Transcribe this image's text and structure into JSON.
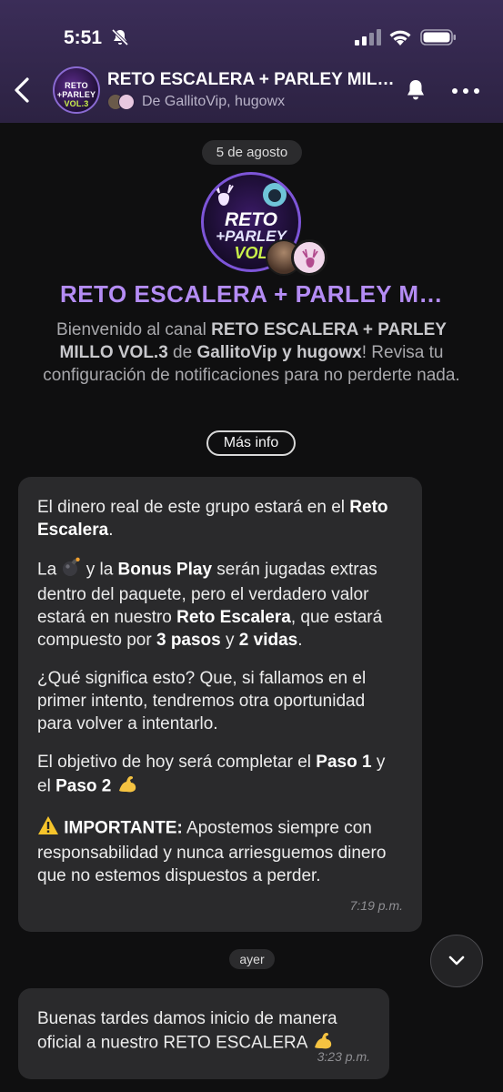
{
  "status_bar": {
    "time": "5:51"
  },
  "header": {
    "title": "RETO ESCALERA + PARLEY MIL…",
    "subtitle": "De GallitoVip, hugowx",
    "avatar_lines": [
      "RETO",
      "+PARLEY",
      "VOL.3"
    ]
  },
  "channel_intro": {
    "date": "5 de agosto",
    "avatar_lines": [
      "RETO",
      "+PARLEY",
      "VOL"
    ],
    "name": "RETO ESCALERA + PARLEY M…",
    "welcome": {
      "part1": "Bienvenido al canal ",
      "channel": "RETO ESCALERA + PARLEY MILLO VOL.3",
      "part2": " de ",
      "owners": "GallitoVip y hugowx",
      "part3": "! Revisa tu configuración de notificaciones para no perderte nada."
    },
    "more_info": "Más info"
  },
  "messages": [
    {
      "p1": {
        "t1": "El dinero real de este grupo estará en el ",
        "b1": "Reto Escalera",
        "t2": "."
      },
      "p2": {
        "t1": "La ",
        "emoji": "💣",
        "t2": " y la ",
        "b1": "Bonus Play",
        "t3": " serán jugadas extras dentro del paquete, pero el verdadero valor estará en nuestro ",
        "b2": "Reto Escalera",
        "t4": ", que estará compuesto por ",
        "b3": "3 pasos",
        "t5": " y ",
        "b4": "2 vidas",
        "t6": "."
      },
      "p3": "¿Qué significa esto? Que, si fallamos en el primer intento, tendremos otra oportunidad para volver a intentarlo.",
      "p4": {
        "t1": "El objetivo de hoy será completar el ",
        "b1": "Paso 1",
        "t2": " y el ",
        "b2": "Paso 2",
        "emoji": "💪"
      },
      "p5": {
        "emoji": "⚠️",
        "b1": "IMPORTANTE:",
        "t1": " Apostemos siempre con responsabilidad y nunca arriesguemos dinero que no estemos dispuestos a perder."
      },
      "time": "7:19 p.m."
    },
    {
      "text": "Buenas tardes damos inicio de manera oficial a nuestro RETO ESCALERA",
      "emoji": "💪",
      "time": "3:23 p.m."
    }
  ],
  "day_separator": "ayer",
  "colors": {
    "header_bg": "#3b2d58",
    "background": "#0f0f10",
    "bubble_bg": "#2a2a2c",
    "channel_name": "#b48cf4",
    "muted_text": "#a9a9ad"
  },
  "icons": {
    "back": "chevron-left-icon",
    "notifications": "bell-icon",
    "more": "more-horizontal-icon",
    "scroll_down": "chevron-down-icon",
    "silent": "bell-slash-icon"
  }
}
